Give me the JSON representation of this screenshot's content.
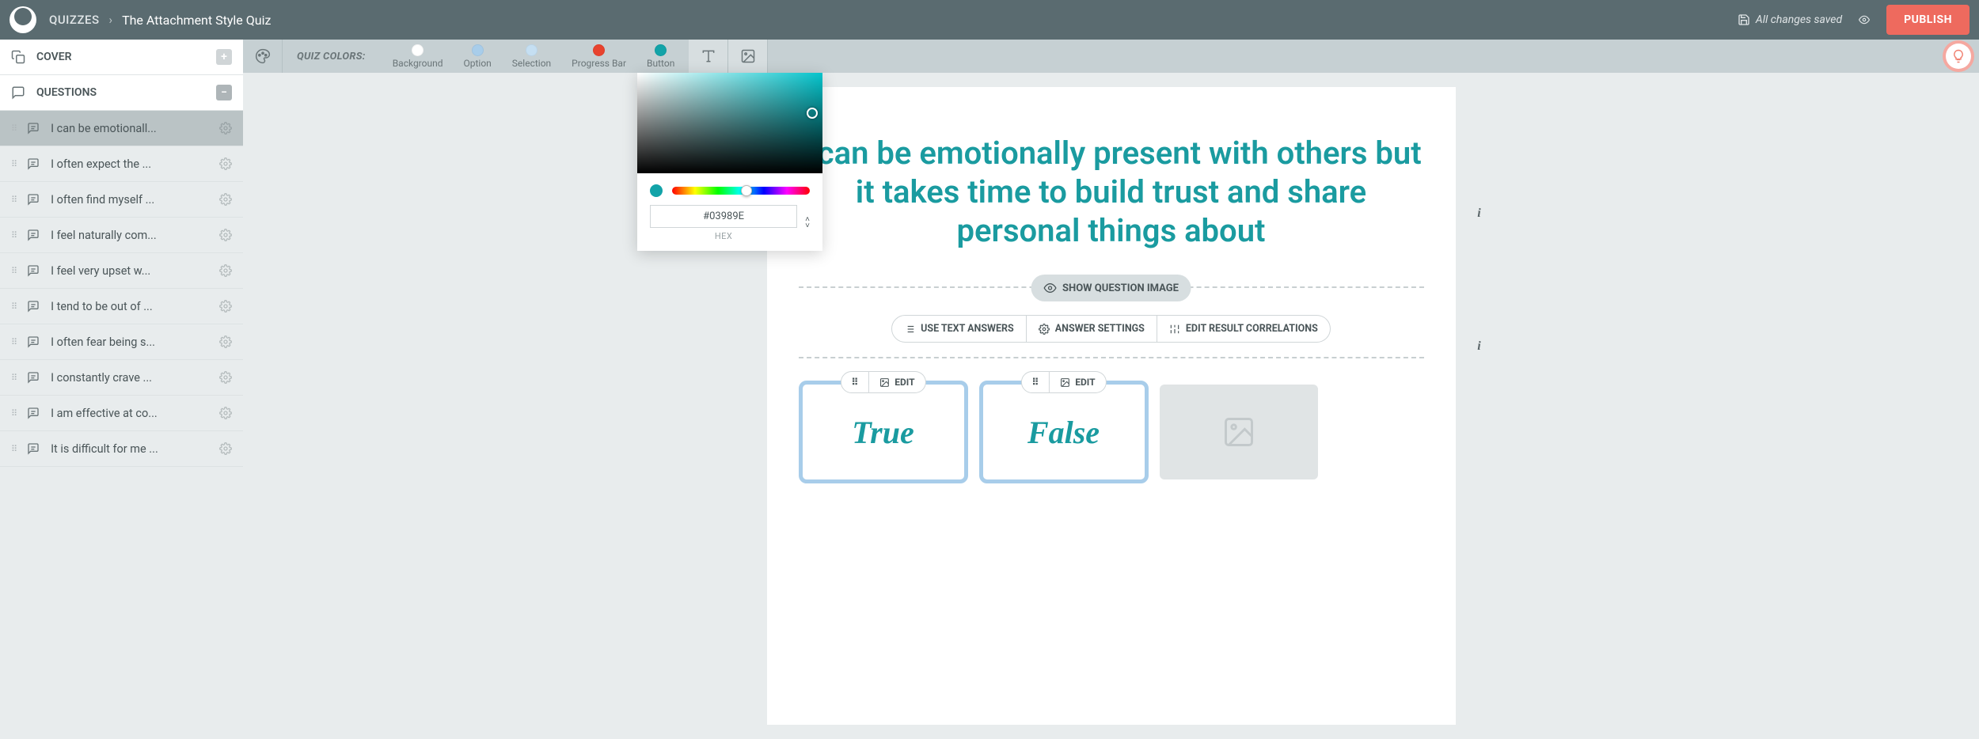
{
  "header": {
    "breadcrumb_section": "QUIZZES",
    "title": "The Attachment Style Quiz",
    "save_status": "All changes saved",
    "publish_label": "PUBLISH"
  },
  "sidebar": {
    "cover_label": "COVER",
    "questions_label": "QUESTIONS",
    "questions": [
      "I can be emotionall...",
      "I often expect the ...",
      "I often find myself ...",
      "I feel naturally com...",
      "I feel very upset w...",
      "I tend to be out of ...",
      "I often fear being s...",
      "I constantly crave ...",
      "I am effective at co...",
      "It is difficult for me ..."
    ]
  },
  "toolbar": {
    "colors_label": "QUIZ COLORS:",
    "swatches": [
      {
        "label": "Background",
        "color": "#ffffff"
      },
      {
        "label": "Option",
        "color": "#a8cdea"
      },
      {
        "label": "Selection",
        "color": "#c5dff2"
      },
      {
        "label": "Progress Bar",
        "color": "#e8432e"
      },
      {
        "label": "Button",
        "color": "#12a3a8"
      }
    ]
  },
  "canvas": {
    "question_text": "I can be emotionally present with others but it takes time to build trust and share personal things about",
    "show_image_label": "SHOW QUESTION IMAGE",
    "answer_toolbar": {
      "use_text": "USE TEXT ANSWERS",
      "settings": "ANSWER SETTINGS",
      "correlations": "EDIT RESULT CORRELATIONS"
    },
    "answers": [
      {
        "label": "True",
        "edit": "EDIT"
      },
      {
        "label": "False",
        "edit": "EDIT"
      }
    ]
  },
  "color_picker": {
    "hex_value": "#03989E",
    "hex_label": "HEX",
    "current_color": "#12a3a8"
  }
}
